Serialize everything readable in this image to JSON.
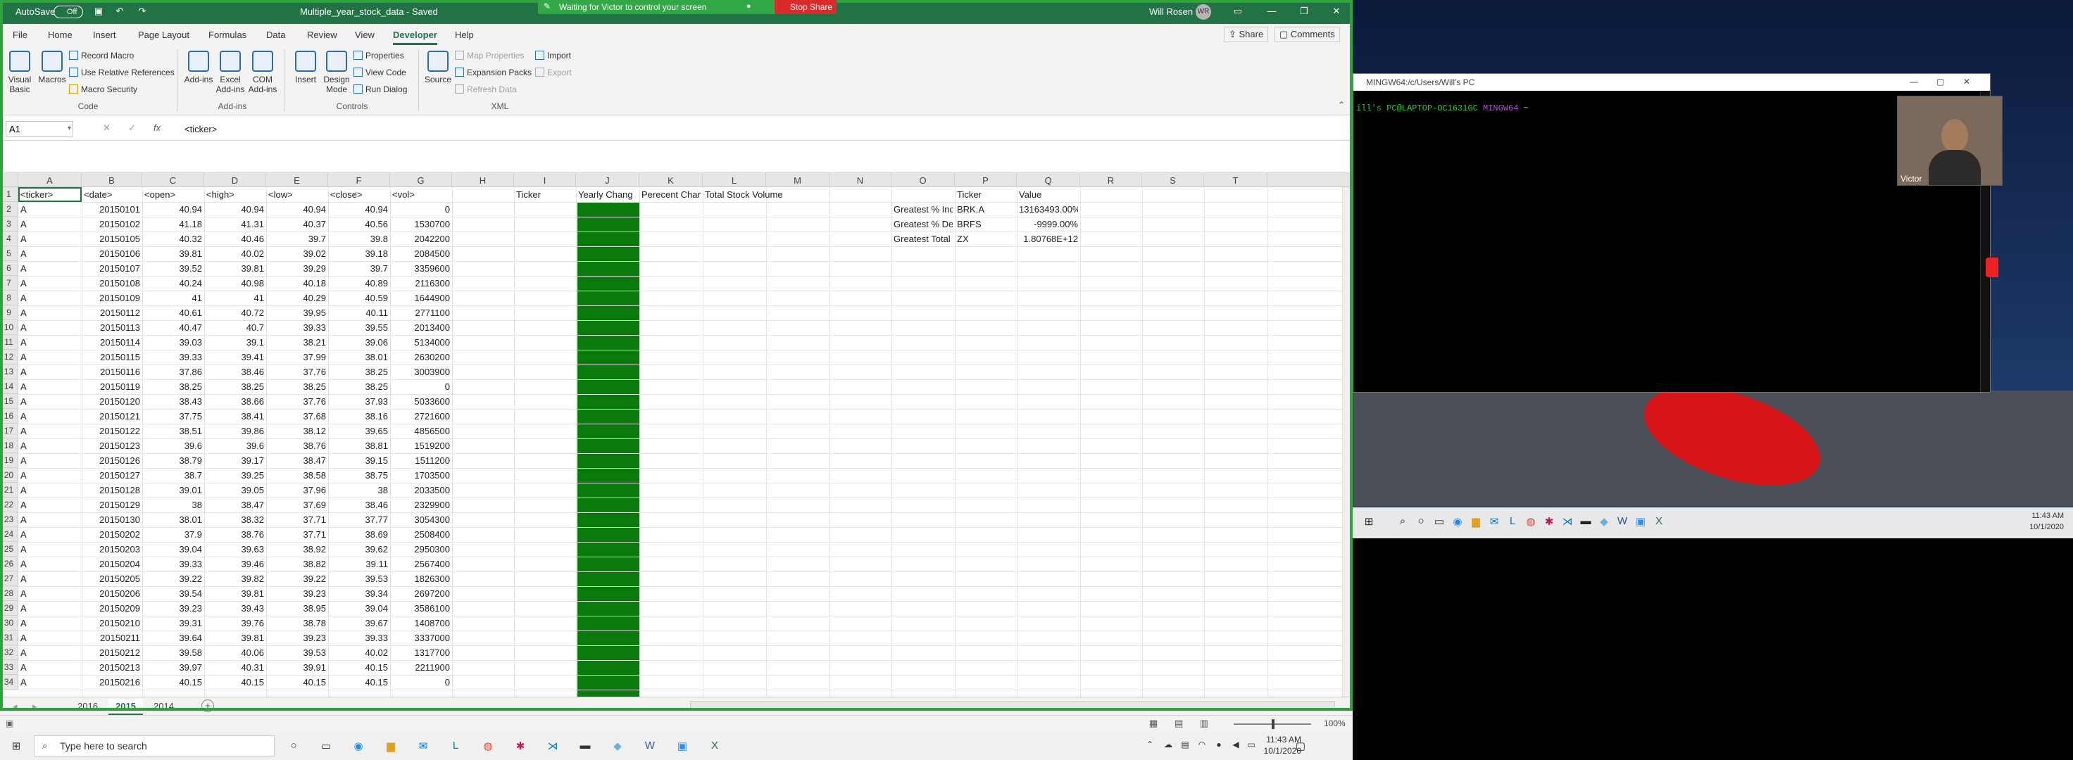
{
  "excel": {
    "autosave_label": "AutoSave",
    "autosave_state": "Off",
    "file_title": "Multiple_year_stock_data - Saved",
    "user": "Will Rosen",
    "user_initials": "WR",
    "share_banner": "Waiting for Victor to control your screen",
    "stop_share": "Stop Share",
    "menu_tabs": [
      "File",
      "Home",
      "Insert",
      "Page Layout",
      "Formulas",
      "Data",
      "Review",
      "View",
      "Developer",
      "Help"
    ],
    "active_tab": "Developer",
    "share_btn": "Share",
    "comments_btn": "Comments",
    "ribbon": {
      "visual_basic": "Visual Basic",
      "macros": "Macros",
      "record_macro": "Record Macro",
      "use_relative": "Use Relative References",
      "macro_security": "Macro Security",
      "group_code": "Code",
      "addins": "Add-ins",
      "excel_addins": "Excel Add-ins",
      "com_addins": "COM Add-ins",
      "group_addins": "Add-ins",
      "insert": "Insert",
      "design_mode": "Design Mode",
      "properties": "Properties",
      "view_code": "View Code",
      "run_dialog": "Run Dialog",
      "group_controls": "Controls",
      "source": "Source",
      "map_properties": "Map Properties",
      "expansion_packs": "Expansion Packs",
      "refresh_data": "Refresh Data",
      "import": "Import",
      "export": "Export",
      "group_xml": "XML"
    },
    "name_box": "A1",
    "formula": "<ticker>",
    "columns": [
      "A",
      "B",
      "C",
      "D",
      "E",
      "F",
      "G",
      "H",
      "I",
      "J",
      "K",
      "L",
      "M",
      "N",
      "O",
      "P",
      "Q",
      "R",
      "S",
      "T"
    ],
    "header_row": [
      "<ticker>",
      "<date>",
      "<open>",
      "<high>",
      "<low>",
      "<close>",
      "<vol>"
    ],
    "summary_headers": {
      "ticker": "Ticker",
      "yearly": "Yearly Chang",
      "percent": "Perecent Chang",
      "total": "Total Stock Volume"
    },
    "greatest": {
      "headers": {
        "ticker": "Ticker",
        "value": "Value"
      },
      "rows": [
        {
          "label": "Greatest % Increase",
          "ticker": "BRK.A",
          "value": "13163493.00%"
        },
        {
          "label": "Greatest % Decrease",
          "ticker": "BRFS",
          "value": "-9999.00%"
        },
        {
          "label": "Greatest Total Volume",
          "ticker": "ZX",
          "value": "1.80768E+12"
        }
      ]
    },
    "rows": [
      [
        "A",
        "20150101",
        "40.94",
        "40.94",
        "40.94",
        "40.94",
        "0"
      ],
      [
        "A",
        "20150102",
        "41.18",
        "41.31",
        "40.37",
        "40.56",
        "1530700"
      ],
      [
        "A",
        "20150105",
        "40.32",
        "40.46",
        "39.7",
        "39.8",
        "2042200"
      ],
      [
        "A",
        "20150106",
        "39.81",
        "40.02",
        "39.02",
        "39.18",
        "2084500"
      ],
      [
        "A",
        "20150107",
        "39.52",
        "39.81",
        "39.29",
        "39.7",
        "3359600"
      ],
      [
        "A",
        "20150108",
        "40.24",
        "40.98",
        "40.18",
        "40.89",
        "2116300"
      ],
      [
        "A",
        "20150109",
        "41",
        "41",
        "40.29",
        "40.59",
        "1644900"
      ],
      [
        "A",
        "20150112",
        "40.61",
        "40.72",
        "39.95",
        "40.11",
        "2771100"
      ],
      [
        "A",
        "20150113",
        "40.47",
        "40.7",
        "39.33",
        "39.55",
        "2013400"
      ],
      [
        "A",
        "20150114",
        "39.03",
        "39.1",
        "38.21",
        "39.06",
        "5134000"
      ],
      [
        "A",
        "20150115",
        "39.33",
        "39.41",
        "37.99",
        "38.01",
        "2630200"
      ],
      [
        "A",
        "20150116",
        "37.86",
        "38.46",
        "37.76",
        "38.25",
        "3003900"
      ],
      [
        "A",
        "20150119",
        "38.25",
        "38.25",
        "38.25",
        "38.25",
        "0"
      ],
      [
        "A",
        "20150120",
        "38.43",
        "38.66",
        "37.76",
        "37.93",
        "5033600"
      ],
      [
        "A",
        "20150121",
        "37.75",
        "38.41",
        "37.68",
        "38.16",
        "2721600"
      ],
      [
        "A",
        "20150122",
        "38.51",
        "39.86",
        "38.12",
        "39.65",
        "4856500"
      ],
      [
        "A",
        "20150123",
        "39.6",
        "39.6",
        "38.76",
        "38.81",
        "1519200"
      ],
      [
        "A",
        "20150126",
        "38.79",
        "39.17",
        "38.47",
        "39.15",
        "1511200"
      ],
      [
        "A",
        "20150127",
        "38.7",
        "39.25",
        "38.58",
        "38.75",
        "1703500"
      ],
      [
        "A",
        "20150128",
        "39.01",
        "39.05",
        "37.96",
        "38",
        "2033500"
      ],
      [
        "A",
        "20150129",
        "38",
        "38.47",
        "37.69",
        "38.46",
        "2329900"
      ],
      [
        "A",
        "20150130",
        "38.01",
        "38.32",
        "37.71",
        "37.77",
        "3054300"
      ],
      [
        "A",
        "20150202",
        "37.9",
        "38.76",
        "37.71",
        "38.69",
        "2508400"
      ],
      [
        "A",
        "20150203",
        "39.04",
        "39.63",
        "38.92",
        "39.62",
        "2950300"
      ],
      [
        "A",
        "20150204",
        "39.33",
        "39.46",
        "38.82",
        "39.11",
        "2567400"
      ],
      [
        "A",
        "20150205",
        "39.22",
        "39.82",
        "39.22",
        "39.53",
        "1826300"
      ],
      [
        "A",
        "20150206",
        "39.54",
        "39.81",
        "39.23",
        "39.34",
        "2697200"
      ],
      [
        "A",
        "20150209",
        "39.23",
        "39.43",
        "38.95",
        "39.04",
        "3586100"
      ],
      [
        "A",
        "20150210",
        "39.31",
        "39.76",
        "38.78",
        "39.67",
        "1408700"
      ],
      [
        "A",
        "20150211",
        "39.64",
        "39.81",
        "39.23",
        "39.33",
        "3337000"
      ],
      [
        "A",
        "20150212",
        "39.58",
        "40.06",
        "39.53",
        "40.02",
        "1317700"
      ],
      [
        "A",
        "20150213",
        "39.97",
        "40.31",
        "39.91",
        "40.15",
        "2211900"
      ],
      [
        "A",
        "20150216",
        "40.15",
        "40.15",
        "40.15",
        "40.15",
        "0"
      ]
    ],
    "sheets": [
      "2016",
      "2015",
      "2014"
    ],
    "active_sheet": "2015",
    "zoom": "100%",
    "taskbar_search": "Type here to search",
    "clock_time": "11:43 AM",
    "clock_date": "10/1/2020"
  },
  "remote": {
    "terminal_title": "MINGW64:/c/Users/Will's PC",
    "prompt_user": "ill's PC@LAPTOP-OC1631GC",
    "prompt_env": "MINGW64",
    "prompt_path": "~",
    "camera_name": "Victor",
    "clock_time": "11:43 AM",
    "clock_date": "10/1/2020"
  }
}
